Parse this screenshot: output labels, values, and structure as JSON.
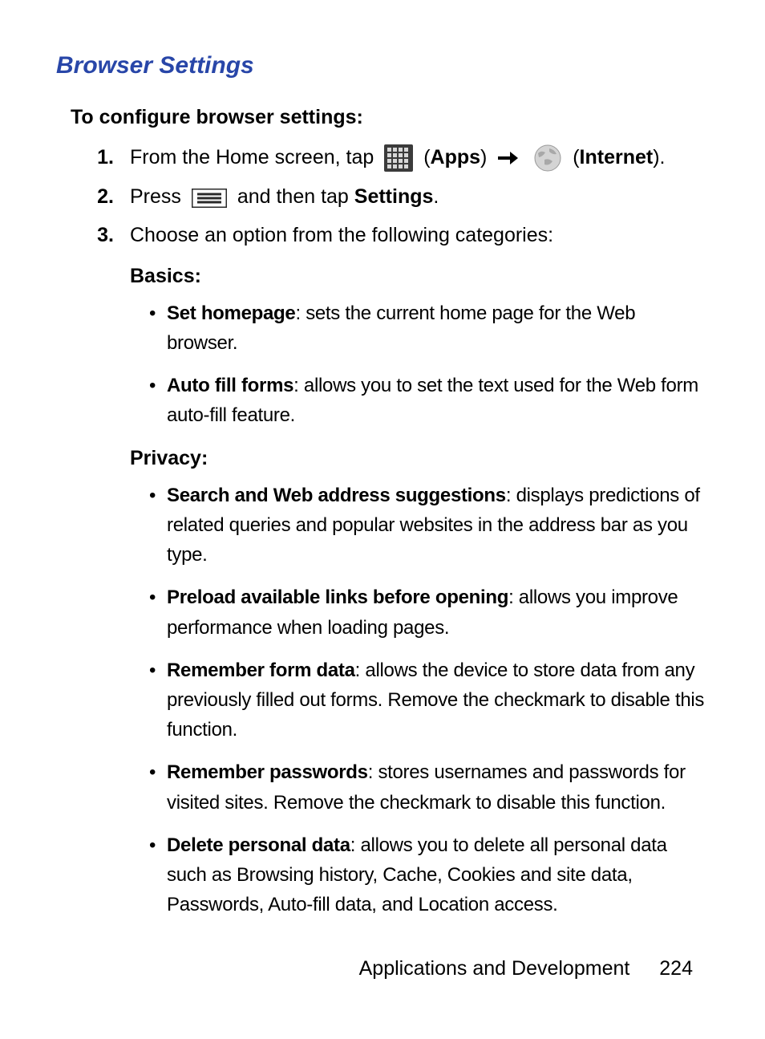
{
  "heading": "Browser Settings",
  "intro": "To configure browser settings:",
  "steps": {
    "s1": {
      "num": "1.",
      "pre": "From the Home screen, tap ",
      "apps_label": "Apps",
      "internet_label": "Internet"
    },
    "s2": {
      "num": "2.",
      "pre": "Press ",
      "mid": " and then tap ",
      "settings_label": "Settings",
      "end": "."
    },
    "s3": {
      "num": "3.",
      "text": "Choose an option from the following categories:"
    }
  },
  "sections": {
    "basics": {
      "label": "Basics:",
      "items": [
        {
          "term": "Set homepage",
          "desc": ": sets the current home page for the Web browser."
        },
        {
          "term": "Auto fill forms",
          "desc": ": allows you to set the text used for the Web form auto-fill feature."
        }
      ]
    },
    "privacy": {
      "label": "Privacy:",
      "items": [
        {
          "term": "Search and Web address suggestions",
          "desc": ": displays predictions of related queries and popular websites in the address bar as you type."
        },
        {
          "term": "Preload available links before opening",
          "desc": ": allows you improve performance when loading pages."
        },
        {
          "term": "Remember form data",
          "desc": ": allows the device to store data from any previously filled out forms. Remove the checkmark to disable this function."
        },
        {
          "term": "Remember passwords",
          "desc": ": stores usernames and passwords for visited sites. Remove the checkmark to disable this function."
        },
        {
          "term": "Delete personal data",
          "desc": ": allows you to delete all personal data such as Browsing history, Cache, Cookies and site data, Passwords, Auto-fill data, and Location access."
        }
      ]
    }
  },
  "footer": {
    "section": "Applications and Development",
    "page": "224"
  }
}
